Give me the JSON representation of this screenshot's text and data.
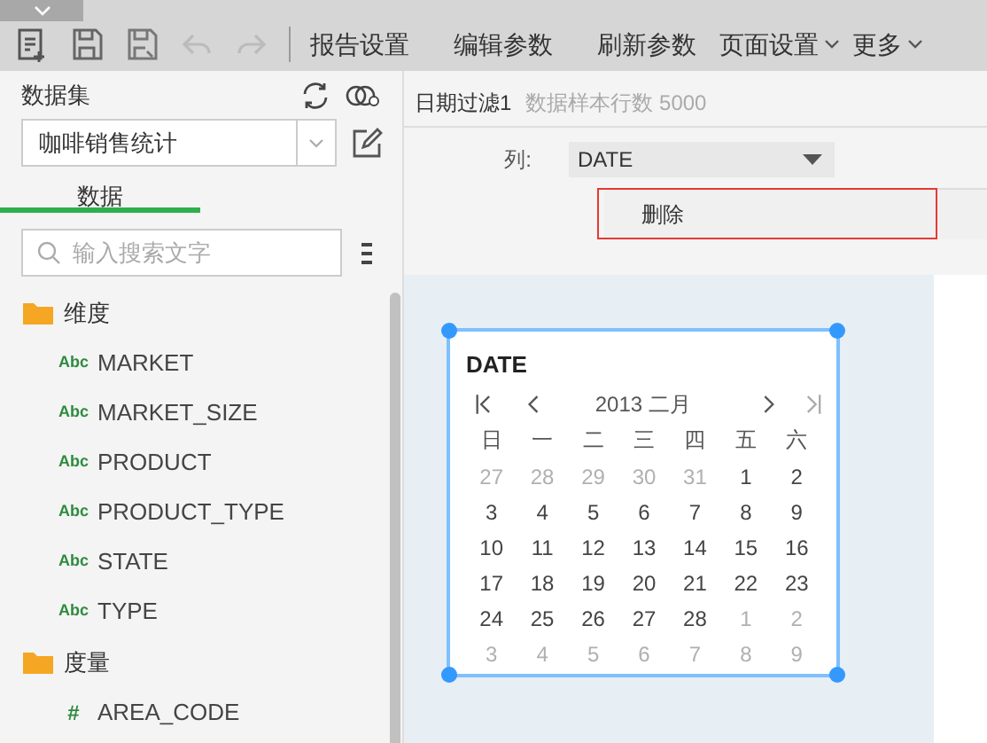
{
  "toolbar": {
    "menus": [
      {
        "label": "报告设置",
        "dropdown": false
      },
      {
        "label": "编辑参数",
        "dropdown": false
      },
      {
        "label": "刷新参数",
        "dropdown": false
      },
      {
        "label": "页面设置",
        "dropdown": true
      },
      {
        "label": "更多",
        "dropdown": true
      }
    ]
  },
  "dataset_panel": {
    "title": "数据集",
    "dataset": "咖啡销售统计",
    "tabs": [
      {
        "label": "数据",
        "selected": true
      }
    ],
    "search": {
      "placeholder": "输入搜索文字"
    },
    "tree": [
      {
        "label": "维度",
        "kind": "folder",
        "children": [
          {
            "label": "MARKET",
            "kind": "text",
            "type_label": "Abc"
          },
          {
            "label": "MARKET_SIZE",
            "kind": "text",
            "type_label": "Abc"
          },
          {
            "label": "PRODUCT",
            "kind": "text",
            "type_label": "Abc"
          },
          {
            "label": "PRODUCT_TYPE",
            "kind": "text",
            "type_label": "Abc"
          },
          {
            "label": "STATE",
            "kind": "text",
            "type_label": "Abc"
          },
          {
            "label": "TYPE",
            "kind": "text",
            "type_label": "Abc"
          }
        ]
      },
      {
        "label": "度量",
        "kind": "folder",
        "children": [
          {
            "label": "AREA_CODE",
            "kind": "number",
            "type_label": "#"
          }
        ]
      }
    ]
  },
  "filter": {
    "name": "日期过滤1",
    "sample_rows": "数据样本行数 5000",
    "column_label": "列:",
    "column": "DATE",
    "menu": [
      "删除"
    ]
  },
  "calendar": {
    "title": "DATE",
    "month": "2013 二月",
    "weekdays": [
      "日",
      "一",
      "二",
      "三",
      "四",
      "五",
      "六"
    ],
    "days": [
      {
        "day": "27",
        "muted": true
      },
      {
        "day": "28",
        "muted": true
      },
      {
        "day": "29",
        "muted": true
      },
      {
        "day": "30",
        "muted": true
      },
      {
        "day": "31",
        "muted": true
      },
      {
        "day": "1",
        "muted": false
      },
      {
        "day": "2",
        "muted": false
      },
      {
        "day": "3",
        "muted": false
      },
      {
        "day": "4",
        "muted": false
      },
      {
        "day": "5",
        "muted": false
      },
      {
        "day": "6",
        "muted": false
      },
      {
        "day": "7",
        "muted": false
      },
      {
        "day": "8",
        "muted": false
      },
      {
        "day": "9",
        "muted": false
      },
      {
        "day": "10",
        "muted": false
      },
      {
        "day": "11",
        "muted": false
      },
      {
        "day": "12",
        "muted": false
      },
      {
        "day": "13",
        "muted": false
      },
      {
        "day": "14",
        "muted": false
      },
      {
        "day": "15",
        "muted": false
      },
      {
        "day": "16",
        "muted": false
      },
      {
        "day": "17",
        "muted": false
      },
      {
        "day": "18",
        "muted": false
      },
      {
        "day": "19",
        "muted": false
      },
      {
        "day": "20",
        "muted": false
      },
      {
        "day": "21",
        "muted": false
      },
      {
        "day": "22",
        "muted": false
      },
      {
        "day": "23",
        "muted": false
      },
      {
        "day": "24",
        "muted": false
      },
      {
        "day": "25",
        "muted": false
      },
      {
        "day": "26",
        "muted": false
      },
      {
        "day": "27",
        "muted": false
      },
      {
        "day": "28",
        "muted": false
      },
      {
        "day": "1",
        "muted": true
      },
      {
        "day": "2",
        "muted": true
      },
      {
        "day": "3",
        "muted": true
      },
      {
        "day": "4",
        "muted": true
      },
      {
        "day": "5",
        "muted": true
      },
      {
        "day": "6",
        "muted": true
      },
      {
        "day": "7",
        "muted": true
      },
      {
        "day": "8",
        "muted": true
      },
      {
        "day": "9",
        "muted": true
      }
    ]
  }
}
